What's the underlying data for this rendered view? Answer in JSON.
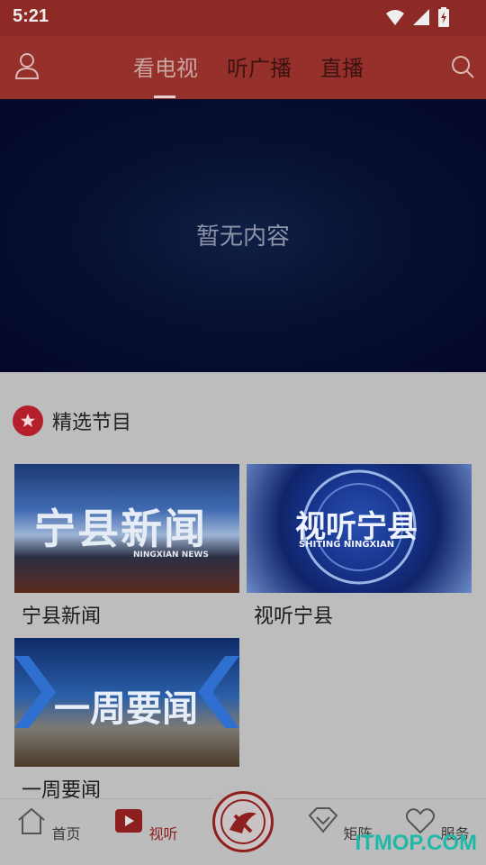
{
  "status_bar": {
    "time": "5:21"
  },
  "header": {
    "tabs": [
      {
        "label": "看电视",
        "active": true
      },
      {
        "label": "听广播",
        "active": false
      },
      {
        "label": "直播",
        "active": false
      }
    ]
  },
  "banner": {
    "empty_text": "暂无内容"
  },
  "section": {
    "title": "精选节目"
  },
  "programs": [
    {
      "title": "宁县新闻",
      "thumb_text": "宁县新闻",
      "thumb_sub": "NINGXIAN NEWS"
    },
    {
      "title": "视听宁县",
      "thumb_text": "视听宁县",
      "thumb_sub": "SHITING NINGXIAN"
    },
    {
      "title": "一周要闻",
      "thumb_text": "一周要闻"
    }
  ],
  "bottom_nav": [
    {
      "label": "首页",
      "icon": "home-icon"
    },
    {
      "label": "视听",
      "icon": "play-icon",
      "active": true
    },
    {
      "label": "",
      "icon": "logo-icon"
    },
    {
      "label": "矩阵",
      "icon": "diamond-icon"
    },
    {
      "label": "服务",
      "icon": "heart-icon"
    }
  ],
  "watermark": "ITMOP.COM",
  "colors": {
    "header": "#95302b",
    "accent": "#8e1f1f",
    "badge": "#b51f2b"
  }
}
